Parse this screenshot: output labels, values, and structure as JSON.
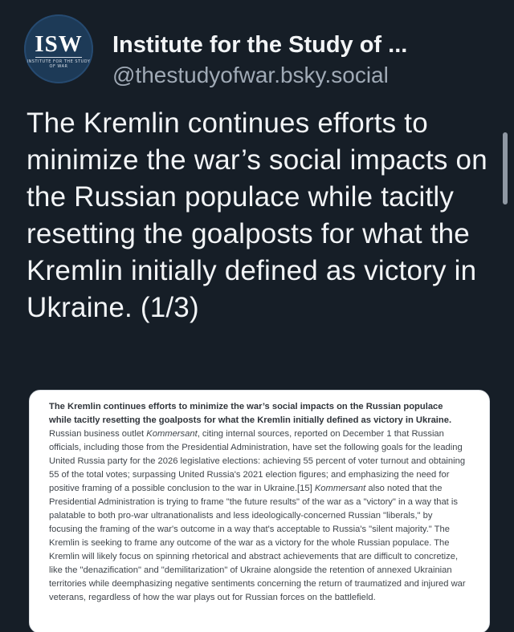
{
  "post": {
    "author_name": "Institute for the Study of ...",
    "author_handle": "@thestudyofwar.bsky.social",
    "avatar": {
      "title": "ISW",
      "subtitle": "INSTITUTE FOR THE STUDY OF WAR"
    },
    "body_text": "The Kremlin continues efforts to minimize the war’s social impacts on the Russian populace while tacitly resetting the goalposts for what the Kremlin initially defined as victory in Ukraine. (1/3)"
  },
  "image": {
    "headline": "The Kremlin continues efforts to minimize the war’s social impacts on the Russian populace while tacitly resetting the goalposts for what the Kremlin initially defined as victory in Ukraine.",
    "p1": "Russian business outlet ",
    "p1_italic": "Kommersant",
    "p2": ", citing internal sources, reported on December 1 that Russian officials, including those from the Presidential Administration, have set the following goals for the leading United Russia party for the 2026 legislative elections: achieving 55 percent of voter turnout and obtaining 55 of the total votes; surpassing United Russia's 2021 election figures; and emphasizing the need for positive framing of a possible conclusion to the war in Ukraine.[15] ",
    "p2_italic": "Kommersant",
    "p3": " also noted that the Presidential Administration is trying to frame \"the future results\" of the war as a \"victory\" in a way that is palatable to both pro-war ultranationalists and less ideologically-concerned Russian \"liberals,\" by focusing the framing of the war's outcome in a way that's acceptable to Russia's \"silent majority.\" The Kremlin is seeking to frame any outcome of the war as a victory for the whole Russian populace. The Kremlin will likely focus on spinning rhetorical and abstract achievements that are difficult to concretize, like the \"denazification\" and \"demilitarization\" of Ukraine alongside the retention of annexed Ukrainian territories while deemphasizing negative sentiments concerning the return of traumatized and injured war veterans, regardless of how the war plays out for Russian forces on the battlefield."
  },
  "colors": {
    "background": "#161e27",
    "text_primary": "#f2f4f6",
    "text_secondary": "#a0aab6",
    "avatar_bg": "#1d3a57"
  }
}
